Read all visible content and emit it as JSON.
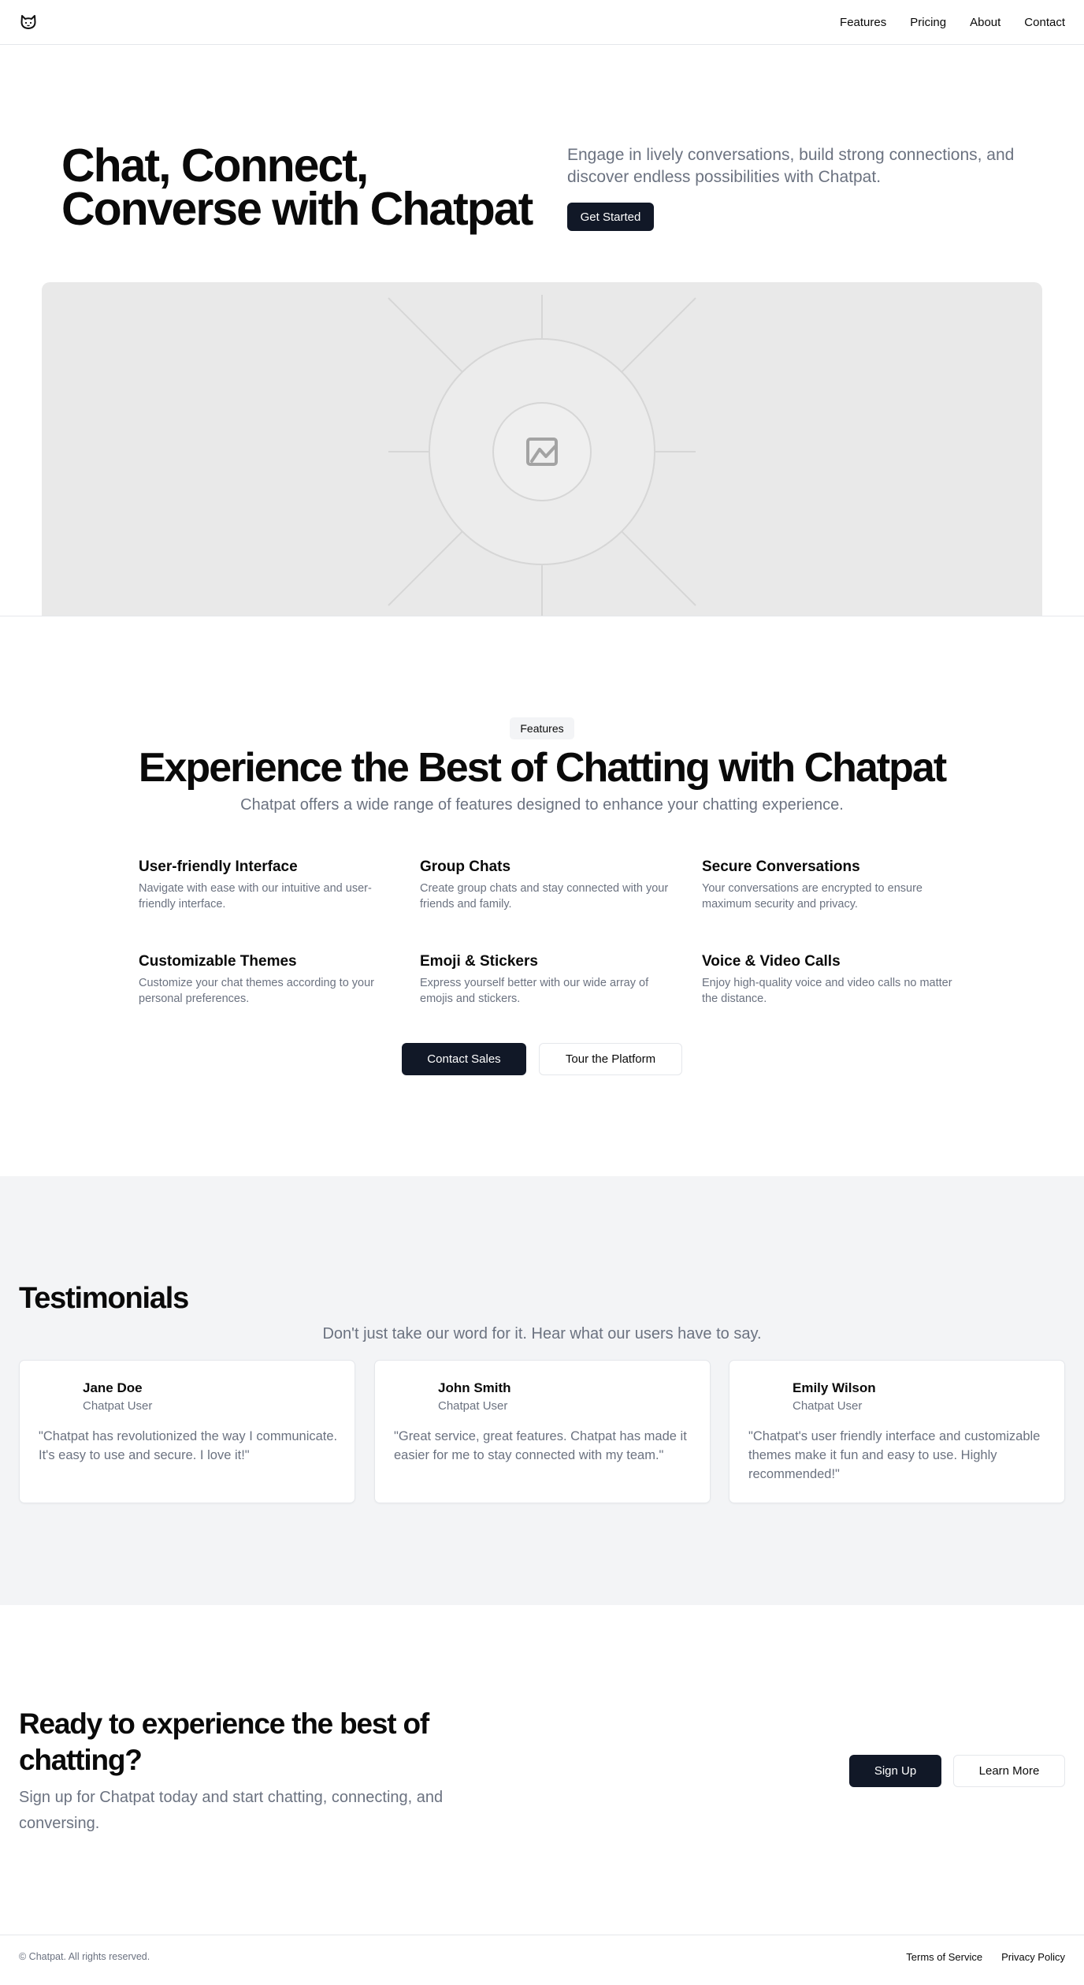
{
  "header": {
    "logo_icon": "cat-face-icon",
    "nav": [
      "Features",
      "Pricing",
      "About",
      "Contact"
    ]
  },
  "hero": {
    "title": "Chat, Connect, Converse with Chatpat",
    "description": "Engage in lively conversations, build strong connections, and discover endless possibilities with Chatpat.",
    "cta_label": "Get Started",
    "image_icon": "image-placeholder-icon"
  },
  "features": {
    "badge": "Features",
    "title": "Experience the Best of Chatting with Chatpat",
    "subtitle": "Chatpat offers a wide range of features designed to enhance your chatting experience.",
    "items": [
      {
        "title": "User-friendly Interface",
        "description": "Navigate with ease with our intuitive and user-friendly interface."
      },
      {
        "title": "Group Chats",
        "description": "Create group chats and stay connected with your friends and family."
      },
      {
        "title": "Secure Conversations",
        "description": "Your conversations are encrypted to ensure maximum security and privacy."
      },
      {
        "title": "Customizable Themes",
        "description": "Customize your chat themes according to your personal preferences."
      },
      {
        "title": "Emoji & Stickers",
        "description": "Express yourself better with our wide array of emojis and stickers."
      },
      {
        "title": "Voice & Video Calls",
        "description": "Enjoy high-quality voice and video calls no matter the distance."
      }
    ],
    "primary_button": "Contact Sales",
    "secondary_button": "Tour the Platform"
  },
  "testimonials": {
    "title": "Testimonials",
    "subtitle": "Don't just take our word for it. Hear what our users have to say.",
    "items": [
      {
        "name": "Jane Doe",
        "role": "Chatpat User",
        "quote": "\"Chatpat has revolutionized the way I communicate. It's easy to use and secure. I love it!\""
      },
      {
        "name": "John Smith",
        "role": "Chatpat User",
        "quote": "\"Great service, great features. Chatpat has made it easier for me to stay connected with my team.\""
      },
      {
        "name": "Emily Wilson",
        "role": "Chatpat User",
        "quote": "\"Chatpat's user friendly interface and customizable themes make it fun and easy to use. Highly recommended!\""
      }
    ]
  },
  "cta": {
    "title": "Ready to experience the best of chatting?",
    "description": "Sign up for Chatpat today and start chatting, connecting, and conversing.",
    "primary_button": "Sign Up",
    "secondary_button": "Learn More"
  },
  "footer": {
    "copyright": "© Chatpat. All rights reserved.",
    "links": [
      "Terms of Service",
      "Privacy Policy"
    ]
  }
}
